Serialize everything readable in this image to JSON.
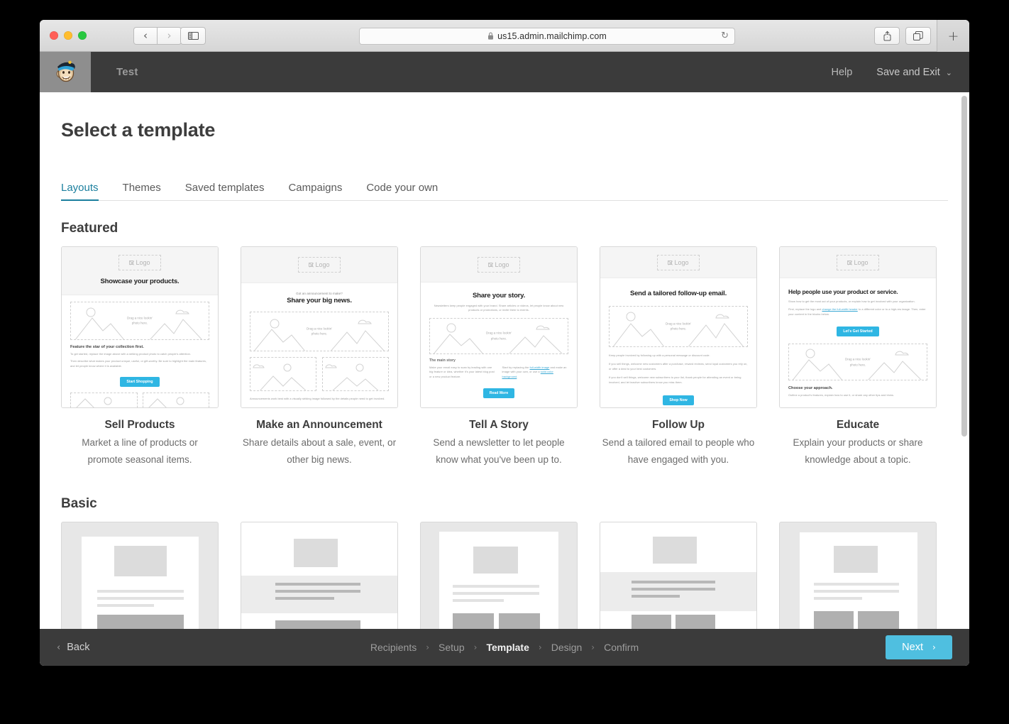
{
  "browser": {
    "url": "us15.admin.mailchimp.com",
    "lock_icon": "lock-icon",
    "reload_icon": "↻",
    "back_icon": "‹",
    "forward_icon": "›",
    "sidebar_icon": "sidebar-icon",
    "share_icon": "share-icon",
    "tabs_icon": "tabs-icon",
    "new_tab_icon": "+"
  },
  "app_header": {
    "logo": "mailchimp-freddie-logo",
    "title": "Test",
    "help_label": "Help",
    "save_exit_label": "Save and Exit",
    "caret_icon": "⌄"
  },
  "page": {
    "title": "Select a template",
    "tabs": [
      {
        "label": "Layouts",
        "active": true
      },
      {
        "label": "Themes",
        "active": false
      },
      {
        "label": "Saved templates",
        "active": false
      },
      {
        "label": "Campaigns",
        "active": false
      },
      {
        "label": "Code your own",
        "active": false
      }
    ],
    "sections": [
      {
        "heading": "Featured"
      },
      {
        "heading": "Basic"
      }
    ]
  },
  "featured": [
    {
      "title": "Sell Products",
      "desc_line1": "Market a line of products or",
      "desc_line2": "promote seasonal items.",
      "logo_label": "Logo",
      "headline": "Showcase your products.",
      "image_caption_l1": "Drag a nice lookin'",
      "image_caption_l2": "photo here.",
      "sub_heading": "Feature the star of your collection first.",
      "body_1": "To get started, replace the image above with a striking product photo to catch people's attention.",
      "body_2": "Then describe what makes your product unique, useful, or gift-worthy. Be sure to highlight the main features, and let people know where it is available.",
      "button": "Start Shopping"
    },
    {
      "title": "Make an Announcement",
      "desc_line1": "Share details about a sale, event, or",
      "desc_line2": "other big news.",
      "logo_label": "Logo",
      "kicker": "Got an announcement to make?",
      "headline": "Share your big news.",
      "image_caption_l1": "Drag a nice lookin'",
      "image_caption_l2": "photo here.",
      "body_1": "Announcements work best with a visually striking image followed by the details people need to get involved."
    },
    {
      "title": "Tell A Story",
      "desc_line1": "Send a newsletter to let people",
      "desc_line2": "know what you've been up to.",
      "logo_label": "Logo",
      "headline": "Share your story.",
      "intro": "Newsletters keep people engaged with your brand. Share articles or videos, let people know about new products or promotions, or invite them to events.",
      "image_caption_l1": "Drag a nice lookin'",
      "image_caption_l2": "photo here.",
      "sub_heading": "The main story",
      "col_left": "Make your email easy to scan by leading with one big feature or idea, whether it's your latest blog post or a new product feature.",
      "col_right_pre": "Start by replacing the ",
      "col_right_link1": "full-width image",
      "col_right_mid": " and make an image with your own, or use a ",
      "col_right_link2": "solid color background",
      "col_right_post": ".",
      "button": "Read More"
    },
    {
      "title": "Follow Up",
      "desc_line1": "Send a tailored email to people who",
      "desc_line2": "have engaged with you.",
      "logo_label": "Logo",
      "headline": "Send a tailored follow-up email.",
      "image_caption_l1": "Drag a nice lookin'",
      "image_caption_l2": "photo here.",
      "body_1": "Keep people involved by following up with a personal message or discount code.",
      "body_2": "If you sell things, welcome new customers after a purchase, reward reviews, send loyal customers you rely on, or offer a deal to your best customers.",
      "body_3": "If you don't sell things, welcome new subscribers to your list, thank people for attending an event or being involved, and let inactive subscribers know you miss them.",
      "button": "Shop Now"
    },
    {
      "title": "Educate",
      "desc_line1": "Explain your products or share",
      "desc_line2": "knowledge about a topic.",
      "logo_label": "Logo",
      "headline": "Help people use your product or service.",
      "body_1": "Show how to get the most out of your products, or explain how to get involved with your organization.",
      "body_2_pre": "First, replace the logo and ",
      "body_2_link": "change the full-width header",
      "body_2_post": " to a different color or to a high-res image. Then, enter your content in the blocks below.",
      "button": "Let's Get Started",
      "image_caption_l1": "Drag a nice lookin'",
      "image_caption_l2": "photo here.",
      "sub_heading": "Choose your approach.",
      "body_3": "Outline a product's features, explain how to use it, or share any other tips and tricks."
    }
  ],
  "basic": [
    {
      "name": "basic-template-1",
      "layout": "framed-single-image"
    },
    {
      "name": "basic-template-2",
      "layout": "band-single-image"
    },
    {
      "name": "basic-template-3",
      "layout": "framed-two-column"
    },
    {
      "name": "basic-template-4",
      "layout": "band-two-column"
    },
    {
      "name": "basic-template-5",
      "layout": "framed-two-column-alt"
    }
  ],
  "footer": {
    "back_label": "Back",
    "back_icon": "‹",
    "steps": [
      {
        "label": "Recipients",
        "current": false
      },
      {
        "label": "Setup",
        "current": false
      },
      {
        "label": "Template",
        "current": true
      },
      {
        "label": "Design",
        "current": false
      },
      {
        "label": "Confirm",
        "current": false
      }
    ],
    "separator_icon": "›",
    "next_label": "Next",
    "next_icon": "›"
  },
  "colors": {
    "accent": "#2fb6e3",
    "next_button": "#4fbfe0",
    "tab_active": "#1b7f9e",
    "chrome_dark": "#3b3b3b"
  }
}
